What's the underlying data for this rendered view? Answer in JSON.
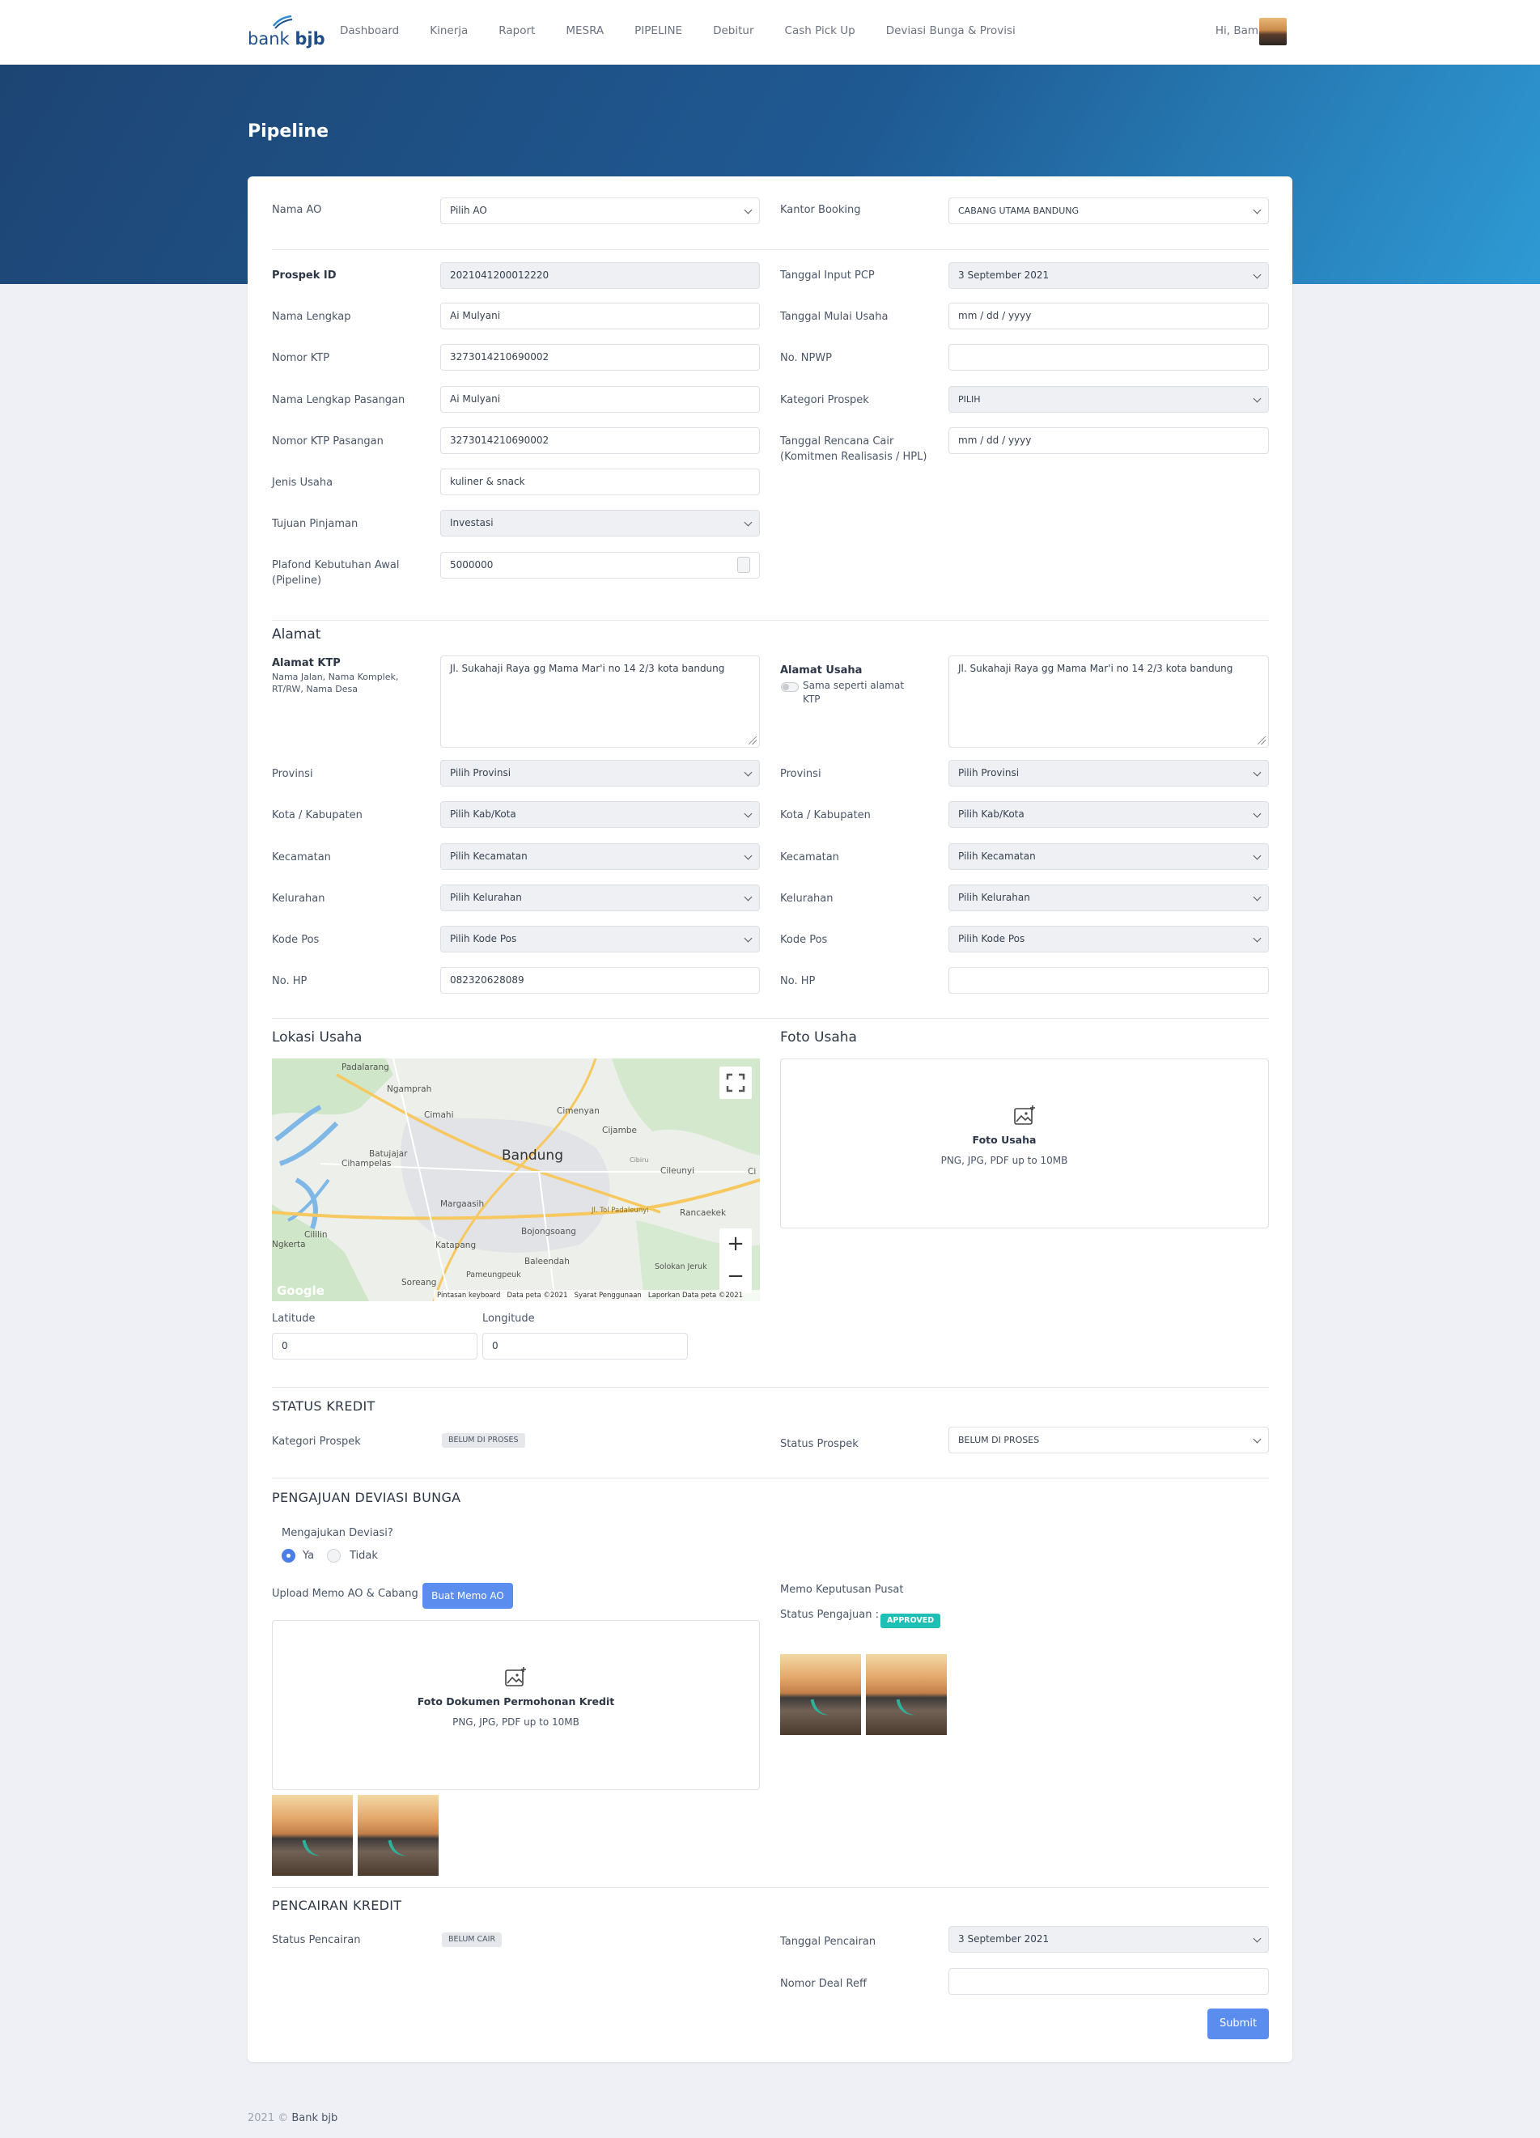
{
  "nav": {
    "logo_word_1": "bank",
    "logo_word_2": "bjb",
    "links": [
      "Dashboard",
      "Kinerja",
      "Raport",
      "MESRA",
      "PIPELINE",
      "Debitur",
      "Cash Pick Up",
      "Deviasi Bunga & Provisi"
    ],
    "greeting": "Hi, Bambang"
  },
  "page": {
    "title": "Pipeline"
  },
  "form": {
    "nama_ao": {
      "label": "Nama AO",
      "value": "Pilih AO"
    },
    "kantor_booking": {
      "label": "Kantor Booking",
      "value": "CABANG UTAMA BANDUNG"
    },
    "prospek_id": {
      "label": "Prospek ID",
      "value": "2021041200012220"
    },
    "tanggal_input_pcp": {
      "label": "Tanggal Input PCP",
      "value": "3 September 2021"
    },
    "nama_lengkap": {
      "label": "Nama Lengkap",
      "value": "Ai Mulyani"
    },
    "tanggal_mulai_usaha": {
      "label": "Tanggal Mulai Usaha",
      "placeholder": "mm / dd / yyyy"
    },
    "nomor_ktp": {
      "label": "Nomor KTP",
      "value": "3273014210690002"
    },
    "no_npwp": {
      "label": "No. NPWP",
      "value": ""
    },
    "nama_pasangan": {
      "label": "Nama Lengkap Pasangan",
      "value": "Ai Mulyani"
    },
    "kategori_prospek": {
      "label": "Kategori Prospek",
      "value": "PILIH"
    },
    "ktp_pasangan": {
      "label": "Nomor KTP Pasangan",
      "value": "3273014210690002"
    },
    "tanggal_rencana_cair": {
      "label": "Tanggal Rencana Cair",
      "label2": "(Komitmen Realisasis / HPL)",
      "placeholder": "mm / dd / yyyy"
    },
    "jenis_usaha": {
      "label": "Jenis Usaha",
      "value": "kuliner & snack"
    },
    "tujuan_pinjaman": {
      "label": "Tujuan Pinjaman",
      "value": "Investasi"
    },
    "plafond": {
      "label": "Plafond Kebutuhan Awal",
      "label2": "(Pipeline)",
      "value": "5000000"
    }
  },
  "alamat": {
    "title": "Alamat",
    "ktp_label": "Alamat KTP",
    "ktp_hint": "Nama Jalan, Nama Komplek, RT/RW, Nama Desa",
    "ktp_value": "Jl. Sukahaji Raya gg Mama Mar'i no 14 2/3 kota bandung",
    "usaha_label": "Alamat Usaha",
    "same_toggle": "Sama seperti alamat KTP",
    "usaha_value": "Jl. Sukahaji Raya gg Mama Mar'i no 14 2/3 kota bandung",
    "provinsi": {
      "label": "Provinsi",
      "value": "Pilih Provinsi"
    },
    "kota": {
      "label": "Kota / Kabupaten",
      "value": "Pilih Kab/Kota"
    },
    "kecamatan": {
      "label": "Kecamatan",
      "value": "Pilih Kecamatan"
    },
    "kelurahan": {
      "label": "Kelurahan",
      "value": "Pilih Kelurahan"
    },
    "kode_pos": {
      "label": "Kode Pos",
      "value": "Pilih Kode Pos"
    },
    "no_hp": {
      "label": "No. HP",
      "value_left": "082320628089",
      "value_right": ""
    }
  },
  "lokasi": {
    "title": "Lokasi Usaha",
    "map_labels": [
      "Padalarang",
      "Ngamprah",
      "Cimahi",
      "Cimenyan",
      "Cijambe",
      "Batujajar",
      "Cihampelas",
      "Bandung",
      "Cibiru",
      "Cileunyi",
      "Margaasih",
      "Cililin",
      "Ngkerta",
      "Katapang",
      "Bojongsoang",
      "Baleendah",
      "Rancaekek",
      "Soreang",
      "Pameungpeuk",
      "Solokan Jeruk",
      "Jl. Tol Padaleunyi",
      "Ci"
    ],
    "map_footer": [
      "Pintasan keyboard",
      "Data peta ©2021",
      "Syarat Penggunaan",
      "Laporkan",
      "Data peta ©2021"
    ],
    "google": "Google",
    "latitude_label": "Latitude",
    "latitude_value": "0",
    "longitude_label": "Longitude",
    "longitude_value": "0"
  },
  "foto_usaha": {
    "title": "Foto Usaha",
    "upload_title": "Foto Usaha",
    "upload_hint": "PNG, JPG, PDF up to 10MB"
  },
  "status_kredit": {
    "title": "STATUS KREDIT",
    "kategori_label": "Kategori Prospek",
    "kategori_badge": "BELUM DI PROSES",
    "status_label": "Status Prospek",
    "status_value": "BELUM DI PROSES"
  },
  "deviasi": {
    "title": "PENGAJUAN DEVIASI BUNGA",
    "question": "Mengajukan Deviasi?",
    "opt_yes": "Ya",
    "opt_no": "Tidak",
    "upload_label": "Upload Memo AO & Cabang",
    "memo_button": "Buat Memo AO",
    "upload_title": "Foto Dokumen Permohonan Kredit",
    "upload_hint": "PNG, JPG, PDF up to 10MB",
    "memo_pusat": "Memo Keputusan Pusat",
    "status_label": "Status Pengajuan :",
    "status_badge": "APPROVED"
  },
  "pencairan": {
    "title": "PENCAIRAN KREDIT",
    "status_label": "Status Pencairan",
    "status_badge": "BELUM CAIR",
    "tanggal_label": "Tanggal Pencairan",
    "tanggal_value": "3 September 2021",
    "deal_label": "Nomor Deal Reff",
    "deal_value": "",
    "submit": "Submit"
  },
  "footer": {
    "year": "2021 ©",
    "brand": "Bank bjb"
  },
  "colors": {
    "brand": "#1e4f8a",
    "primary_button": "#5b8def",
    "approved": "#1ec0b5",
    "hero_start": "#1d4574",
    "hero_end": "#2e9ad4"
  }
}
